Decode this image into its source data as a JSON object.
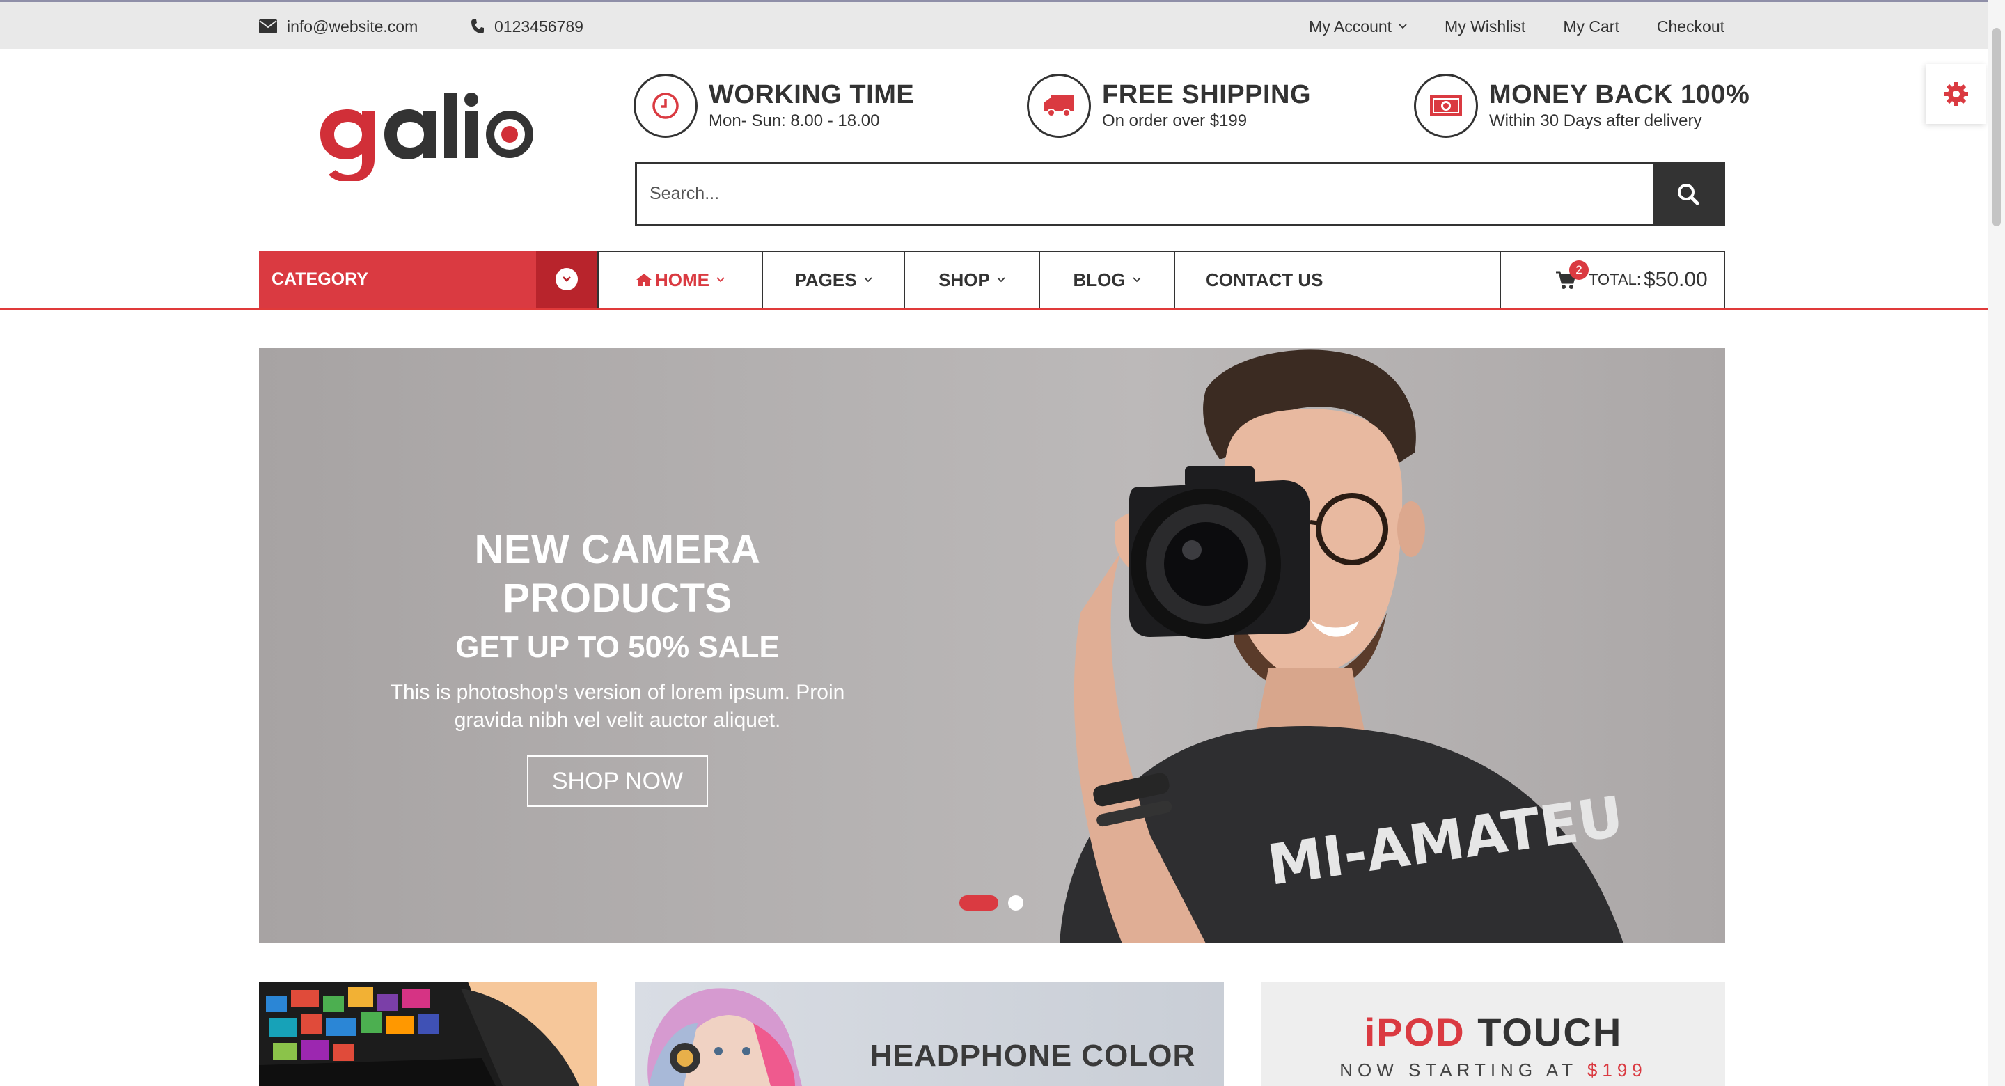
{
  "topbar": {
    "email": "info@website.com",
    "phone": "0123456789",
    "links": {
      "account": "My Account",
      "wishlist": "My Wishlist",
      "cart": "My Cart",
      "checkout": "Checkout"
    }
  },
  "brand": {
    "logo_text": "galio",
    "accent": "#da3a41"
  },
  "features": [
    {
      "title": "WORKING TIME",
      "subtitle": "Mon- Sun: 8.00 - 18.00",
      "icon": "clock-icon"
    },
    {
      "title": "FREE SHIPPING",
      "subtitle": "On order over $199",
      "icon": "truck-icon"
    },
    {
      "title": "MONEY BACK 100%",
      "subtitle": "Within 30 Days after delivery",
      "icon": "money-icon"
    }
  ],
  "search": {
    "placeholder": "Search...",
    "value": ""
  },
  "nav": {
    "category": "CATEGORY",
    "items": {
      "home": "HOME",
      "pages": "PAGES",
      "shop": "SHOP",
      "blog": "BLOG",
      "contact": "CONTACT US"
    },
    "cart": {
      "count": "2",
      "total_label": "TOTAL:",
      "total_value": "$50.00"
    }
  },
  "hero": {
    "title": "NEW CAMERA PRODUCTS",
    "subtitle": "GET UP TO 50% SALE",
    "text": "This is photoshop's version of lorem ipsum. Proin gravida nibh vel velit auctor aliquet.",
    "button": "SHOP NOW",
    "slides": 2,
    "active_slide": 1
  },
  "banners": {
    "headphone": "HEADPHONE COLOR",
    "ipod_brand": "iPOD",
    "ipod_product": "TOUCH",
    "ipod_sub": "NOW STARTING AT",
    "ipod_price": "$199"
  }
}
